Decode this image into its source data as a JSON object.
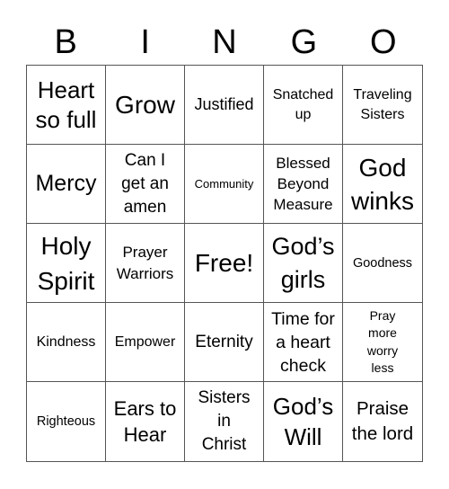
{
  "header": {
    "letters": [
      "B",
      "I",
      "N",
      "G",
      "O"
    ]
  },
  "board": {
    "rows": [
      [
        "Heart so full",
        "Grow",
        "Justified",
        "Snatched up",
        "Traveling Sisters"
      ],
      [
        "Mercy",
        "Can I get an amen",
        "Community",
        "Blessed Beyond Measure",
        "God winks"
      ],
      [
        "Holy Spirit",
        "Prayer Warriors",
        "Free!",
        "God’s girls",
        "Goodness"
      ],
      [
        "Kindness",
        "Empower",
        "Eternity",
        "Time for a heart check",
        "Pray more worry less"
      ],
      [
        "Righteous",
        "Ears to Hear",
        "Sisters in Christ",
        "God’s Will",
        "Praise the lord"
      ]
    ]
  },
  "colors": {
    "grid_line": "#555555",
    "text": "#000000",
    "background": "#ffffff"
  }
}
